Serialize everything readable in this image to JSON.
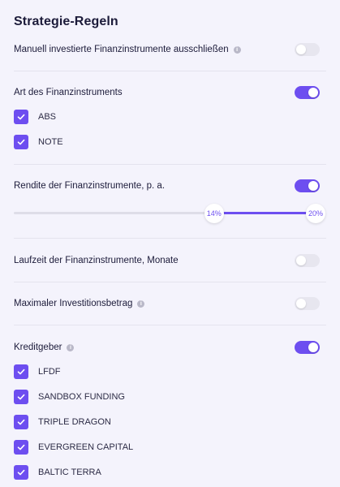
{
  "title": "Strategie-Regeln",
  "rules": {
    "manual": {
      "label": "Manuell investierte Finanzinstrumente ausschließen",
      "info": "i",
      "enabled": false
    },
    "type": {
      "label": "Art des Finanzinstruments",
      "enabled": true,
      "options": [
        "ABS",
        "NOTE"
      ]
    },
    "yield": {
      "label": "Rendite der Finanzinstrumente, p. a.",
      "enabled": true,
      "min_label": "14%",
      "max_label": "20%",
      "min_fraction": 0.652,
      "max_fraction": 1.0
    },
    "term": {
      "label": "Laufzeit der Finanzinstrumente, Monate",
      "enabled": false
    },
    "max_invest": {
      "label": "Maximaler Investitionsbetrag",
      "info": "i",
      "enabled": false
    },
    "lenders": {
      "label": "Kreditgeber",
      "info": "i",
      "enabled": true,
      "options": [
        "LFDF",
        "SANDBOX FUNDING",
        "TRIPLE DRAGON",
        "EVERGREEN CAPITAL",
        "BALTIC TERRA"
      ]
    }
  },
  "colors": {
    "accent": "#6d4ef0",
    "background": "#f4f3fc",
    "toggle_off": "#e7e6ef"
  },
  "icons": {
    "info": "info-icon",
    "check": "checkmark-icon"
  }
}
